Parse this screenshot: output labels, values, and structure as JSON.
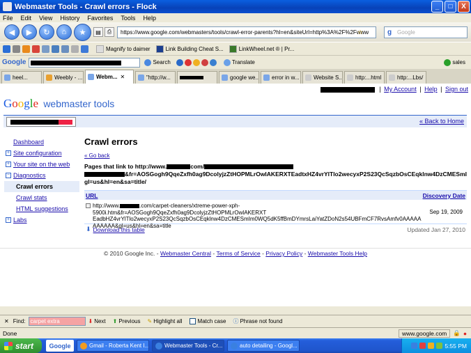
{
  "window": {
    "title": "Webmaster Tools - Crawl errors - Flock",
    "buttons": [
      "_",
      "□",
      "X"
    ]
  },
  "menu": [
    "File",
    "Edit",
    "View",
    "History",
    "Favorites",
    "Tools",
    "Help"
  ],
  "navbar": {
    "url": "https://www.google.com/webmasters/tools/crawl-error-parents?hl=en&siteUrl=http%3A%2F%2Fwww",
    "search_placeholder": "Google"
  },
  "bookmarks": [
    {
      "label": "Magnify to daimer"
    },
    {
      "label": "Link Building Cheat S..."
    },
    {
      "label": "LinkWheel.net ® | Pr..."
    }
  ],
  "google_toolbar": {
    "logo": "Google",
    "search_label": "Search",
    "translate_label": "Translate",
    "sales_label": "sales"
  },
  "tabs": [
    {
      "label": "heel..."
    },
    {
      "label": "Weebly - ..."
    },
    {
      "label": "Webm...",
      "active": true
    },
    {
      "label": "\"http://w..."
    },
    {
      "label": ""
    },
    {
      "label": "google we..."
    },
    {
      "label": "error in w..."
    },
    {
      "label": "Website S..."
    },
    {
      "label": "http:...html"
    },
    {
      "label": "http:...Lbs/"
    }
  ],
  "page": {
    "top_links": {
      "my_account": "My Account",
      "help": "Help",
      "sign_out": "Sign out"
    },
    "logo_suffix": "webmaster tools",
    "back_home": "« Back to Home",
    "sidebar": [
      {
        "label": "Dashboard",
        "type": "link"
      },
      {
        "label": "Site configuration",
        "type": "expand",
        "symbol": "+"
      },
      {
        "label": "Your site on the web",
        "type": "expand",
        "symbol": "+"
      },
      {
        "label": "Diagnostics",
        "type": "expand",
        "symbol": "−"
      },
      {
        "label": "Crawl errors",
        "type": "sub",
        "current": true
      },
      {
        "label": "Crawl stats",
        "type": "sub"
      },
      {
        "label": "HTML suggestions",
        "type": "sub"
      },
      {
        "label": "Labs",
        "type": "expand",
        "symbol": "+"
      }
    ],
    "heading": "Crawl errors",
    "go_back": "« Go back",
    "pages_that_link_prefix": "Pages that link to http://www.",
    "pages_that_link_mid": "com/",
    "pages_that_link_line2": "&fr=AOSGogh9QqeZxfh0ag9DcolyjzZtHOPMLrOwlAKERXTEadtxHZ4vrYlTlo2wecyxP2S23QcSqzbOsCEqklnw4DzCMESmI",
    "pages_that_link_line3": "gl=us&hl=en&sa=title/",
    "table": {
      "col_url": "URL",
      "col_date": "Discovery Date",
      "rows": [
        {
          "url_prefix": "http://www.",
          "url_rest": ".com/carpet-cleaners/xtreme-power-xph-5900i.htm&fr=AOSGogh9QqeZxfh0ag9DcolyjzZtHOPMLrOwlAKERXT EadbHZ4vrYlTlo2wecyxP2S23QcSqzbOsCEqklnw4DzCMESmIm0WQ5dK5ffBmDYmrsLaiYatZDoN2s54UBFmCF7RvsAmfv0AAAAA AAAAAA&gl=us&hl=en&sa=title",
          "date": "Sep 19, 2009"
        }
      ]
    },
    "download": "Download this table",
    "updated": "Updated Jan 27, 2010",
    "footer": {
      "copyright": "© 2010 Google Inc.",
      "links": [
        "Webmaster Central",
        "Terms of Service",
        "Privacy Policy",
        "Webmaster Tools Help"
      ]
    }
  },
  "findbar": {
    "label": "Find:",
    "value": "carpet extra",
    "next": "Next",
    "previous": "Previous",
    "highlight": "Highlight all",
    "match_case": "Match case",
    "status": "Phrase not found"
  },
  "statusbar": {
    "text": "Done",
    "domain": "www.google.com"
  },
  "taskbar": {
    "start": "start",
    "quick": "Google",
    "items": [
      {
        "label": "Gmail - Roberta Kent I..."
      },
      {
        "label": "Webmaster Tools - Cr...",
        "active": true
      },
      {
        "label": "auto detailing - Googl..."
      }
    ],
    "clock": "5:55 PM"
  }
}
